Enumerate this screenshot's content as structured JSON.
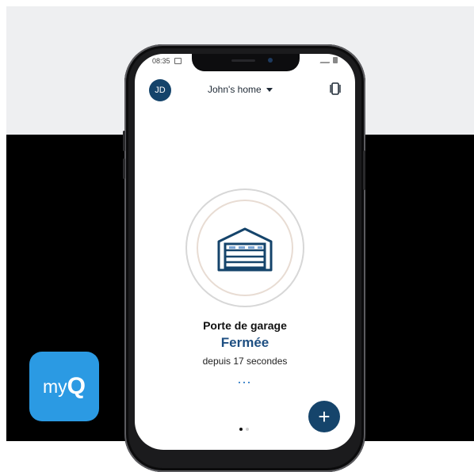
{
  "colors": {
    "brand_navy": "#15446b",
    "status_blue": "#1e4f82",
    "app_icon_blue": "#2b9ae3",
    "background_top": "#eeeff1",
    "background_bottom": "#000000"
  },
  "status_bar": {
    "time": "08:35"
  },
  "header": {
    "avatar_initials": "JD",
    "home_selector": "John's home",
    "home_selector_icon": "chevron-down-icon",
    "device_switch_icon": "device-switch-icon"
  },
  "device": {
    "icon": "garage-door-icon",
    "name": "Porte de garage",
    "status": "Fermée",
    "since": "depuis 17 secondes",
    "more": "···"
  },
  "pager": {
    "pages": 2,
    "active": 1
  },
  "actions": {
    "add": "+",
    "add_icon": "plus-icon"
  },
  "app_logo": {
    "text_my": "my",
    "text_q": "Q"
  }
}
